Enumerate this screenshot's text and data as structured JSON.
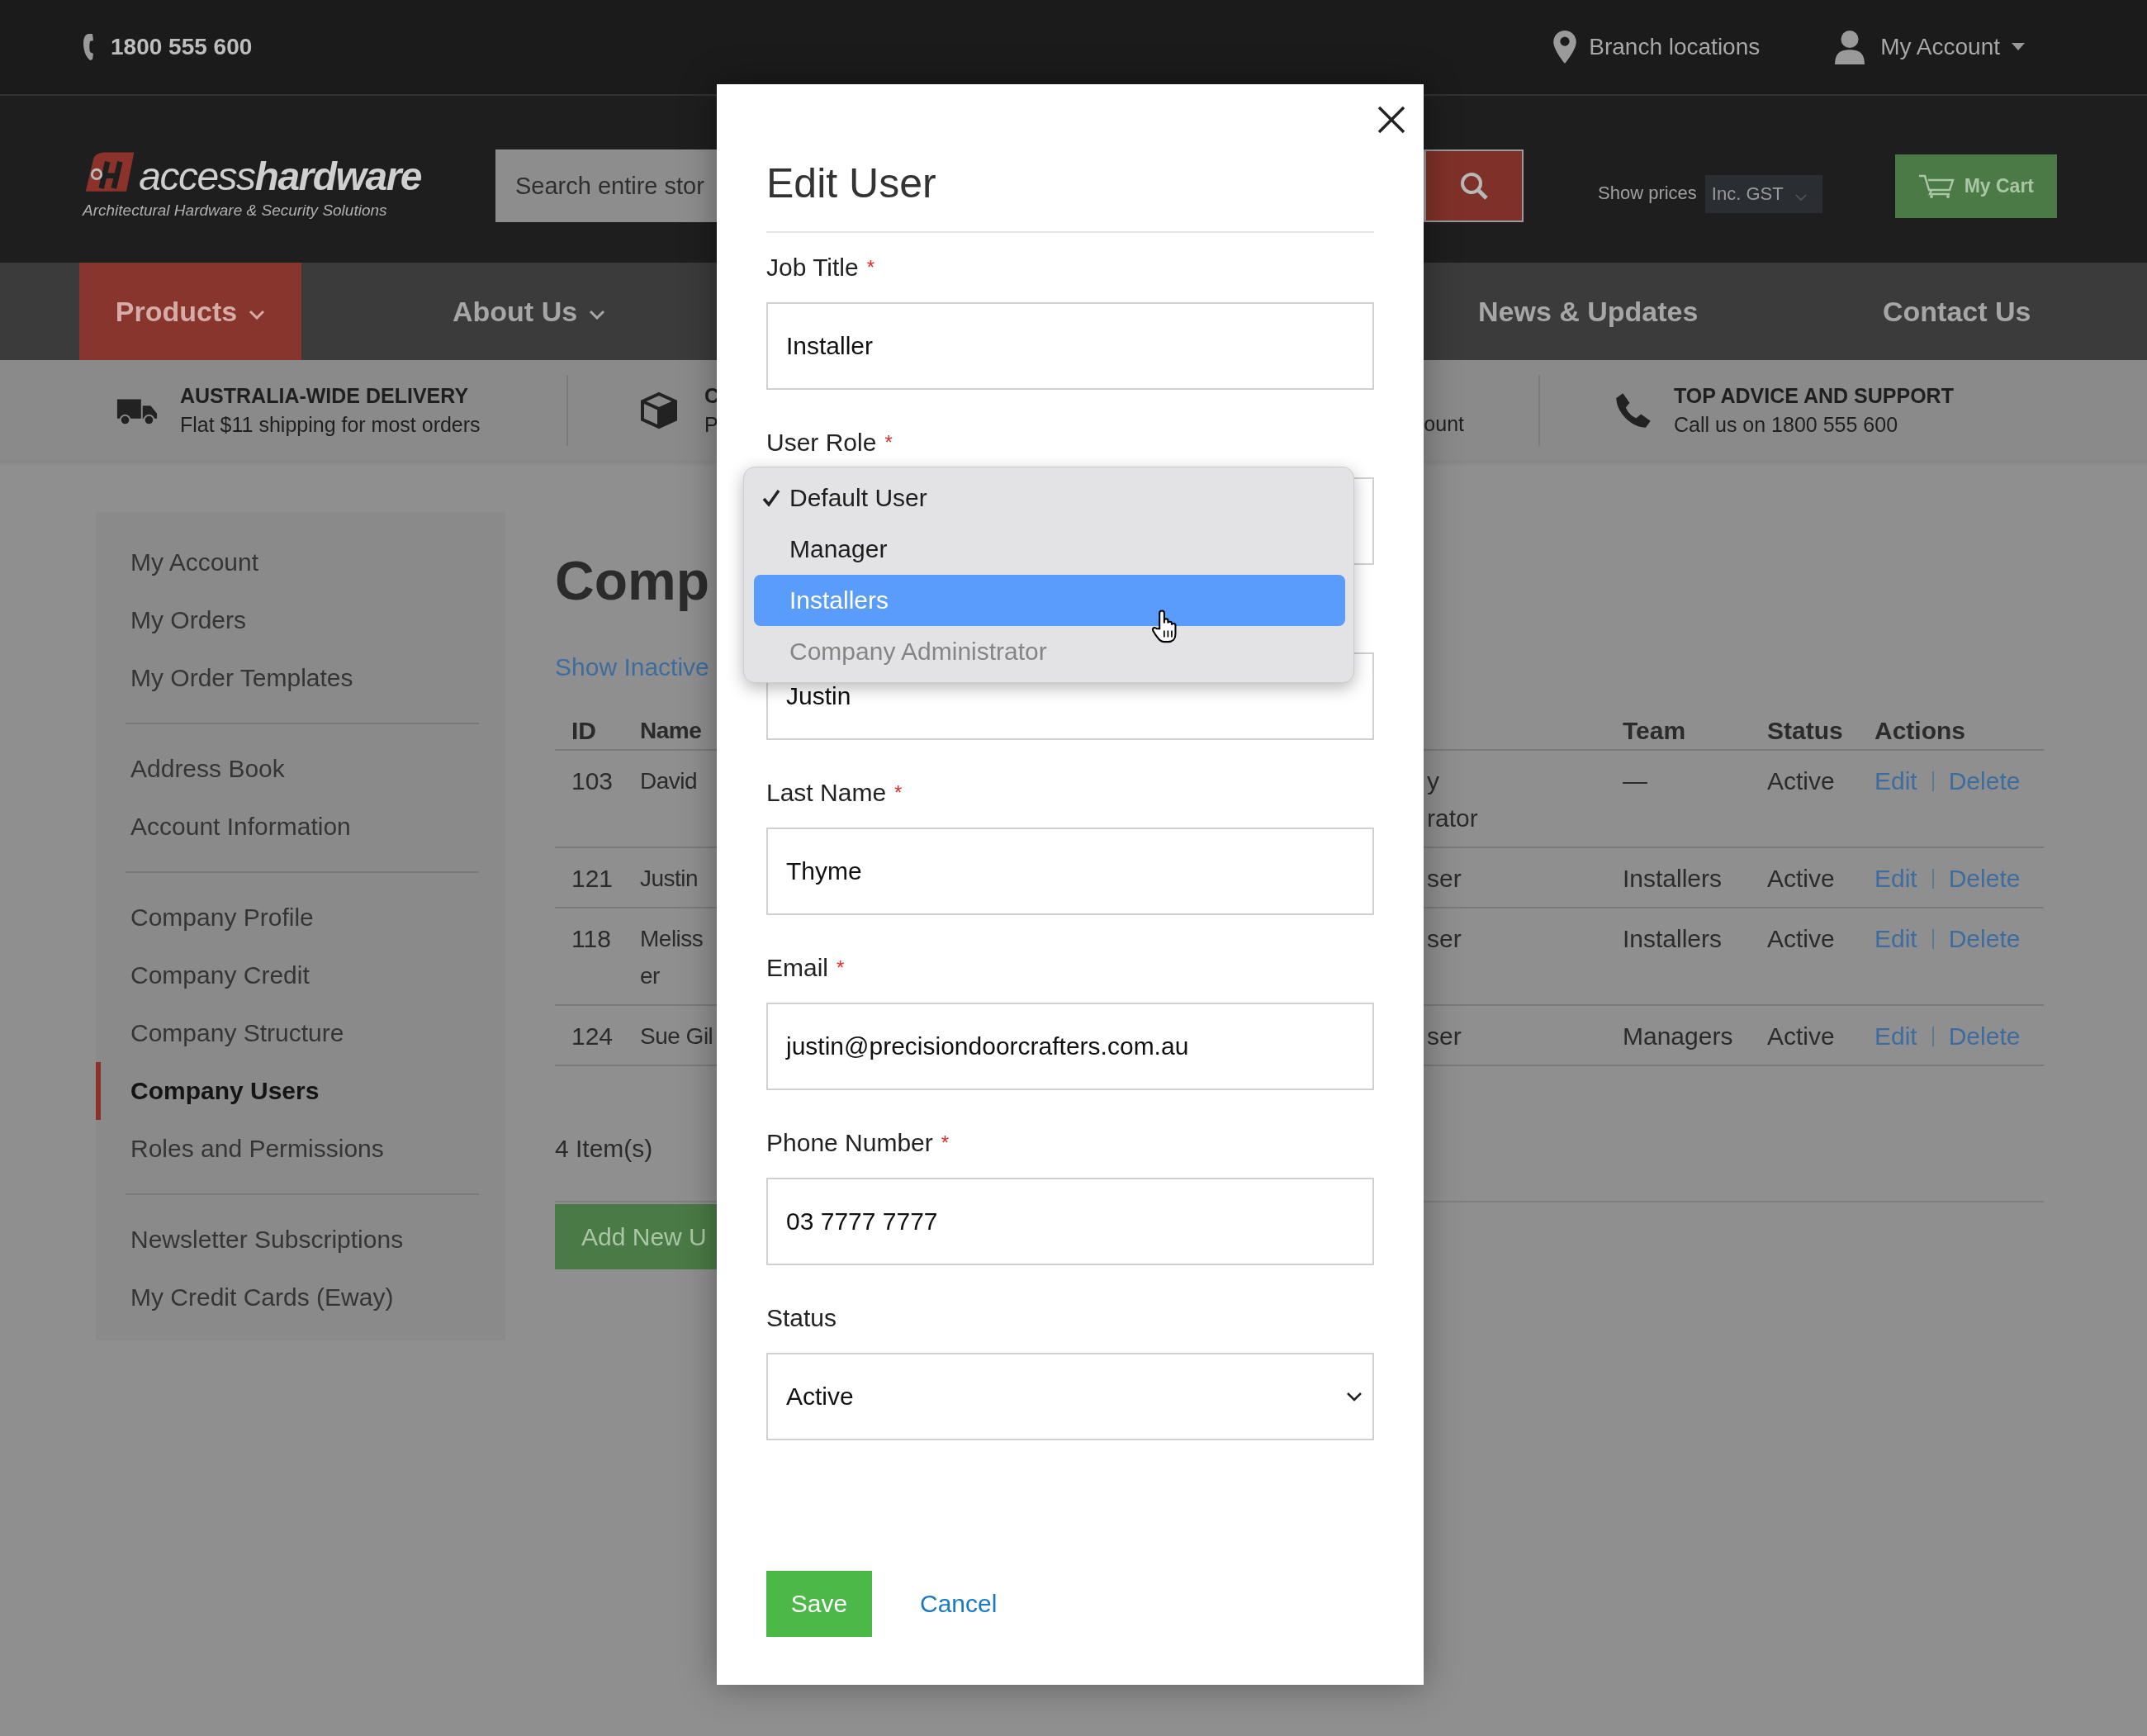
{
  "top_bar": {
    "phone": "1800 555 600",
    "branch_link": "Branch locations",
    "account_link": "My Account"
  },
  "header": {
    "logo_text": "access**hardware**",
    "logo_tagline": "Architectural Hardware & Security Solutions",
    "search_placeholder": "Search entire stor",
    "show_prices_label": "Show prices",
    "price_option": "Inc. GST",
    "cart_label": "My Cart"
  },
  "nav": [
    {
      "label": "Products",
      "selected": true,
      "has_menu": true
    },
    {
      "label": "About Us",
      "selected": false,
      "has_menu": true
    },
    {
      "label": "News & Updates",
      "selected": false,
      "has_menu": false
    },
    {
      "label": "Contact Us",
      "selected": false,
      "has_menu": false
    }
  ],
  "benefits": [
    {
      "title": "AUSTRALIA-WIDE DELIVERY",
      "text": "Flat $11 shipping for most orders"
    },
    {
      "title": "C",
      "text": "P"
    },
    {
      "text": "ount"
    },
    {
      "title": "TOP ADVICE AND SUPPORT",
      "text": "Call us on 1800 555 600"
    }
  ],
  "sidebar": {
    "groups": [
      {
        "items": [
          {
            "label": "My Account",
            "selected": false
          },
          {
            "label": "My Orders",
            "selected": false
          },
          {
            "label": "My Order Templates",
            "selected": false
          }
        ]
      },
      {
        "items": [
          {
            "label": "Address Book",
            "selected": false
          },
          {
            "label": "Account Information",
            "selected": false
          }
        ]
      },
      {
        "items": [
          {
            "label": "Company Profile",
            "selected": false
          },
          {
            "label": "Company Credit",
            "selected": false
          },
          {
            "label": "Company Structure",
            "selected": false
          },
          {
            "label": "Company Users",
            "selected": true
          },
          {
            "label": "Roles and Permissions",
            "selected": false
          }
        ]
      },
      {
        "items": [
          {
            "label": "Newsletter Subscriptions",
            "selected": false
          },
          {
            "label": "My Credit Cards (Eway)",
            "selected": false
          }
        ]
      }
    ]
  },
  "page_title": "Comp",
  "show_inactive_link": "Show Inactive",
  "table": {
    "columns": {
      "id": "ID",
      "name": "Name",
      "team": "Team",
      "status": "Status",
      "actions": "Actions"
    },
    "rows": [
      {
        "id": "103",
        "name": [
          "David"
        ],
        "column_3": [
          "y",
          "rator"
        ],
        "team": "—",
        "status": "Active",
        "actions": [
          "Edit",
          "Delete"
        ]
      },
      {
        "id": "121",
        "name": [
          "Justin"
        ],
        "column_3": [
          "ser"
        ],
        "team": "Installers",
        "status": "Active",
        "actions": [
          "Edit",
          "Delete"
        ]
      },
      {
        "id": "118",
        "name": [
          "Meliss",
          "er"
        ],
        "column_3": [
          "ser"
        ],
        "team": "Installers",
        "status": "Active",
        "actions": [
          "Edit",
          "Delete"
        ]
      },
      {
        "id": "124",
        "name": [
          "Sue Gil"
        ],
        "column_3": [
          "ser"
        ],
        "team": "Managers",
        "status": "Active",
        "actions": [
          "Edit",
          "Delete"
        ]
      }
    ]
  },
  "item_count": "4 Item(s)",
  "add_button": "Add New U",
  "modal": {
    "title": "Edit User",
    "required_mark": "*",
    "fields": [
      {
        "kind": "text",
        "label": "Job Title",
        "required": true,
        "value": "Installer"
      },
      {
        "kind": "dropdown",
        "label": "User Role",
        "required": true,
        "options": [
          {
            "label": "Default User",
            "selected": true,
            "highlighted": false,
            "disabled": false
          },
          {
            "label": "Manager",
            "selected": false,
            "highlighted": false,
            "disabled": false
          },
          {
            "label": "Installers",
            "selected": false,
            "highlighted": true,
            "disabled": false
          },
          {
            "label": "Company Administrator",
            "selected": false,
            "highlighted": false,
            "disabled": true
          }
        ]
      },
      {
        "kind": "text",
        "value": "Justin"
      },
      {
        "kind": "text",
        "label": "Last Name",
        "required": true,
        "value": "Thyme"
      },
      {
        "kind": "text",
        "label": "Email",
        "required": true,
        "value": "justin@precisiondoorcrafters.com.au"
      },
      {
        "kind": "text",
        "label": "Phone Number",
        "required": true,
        "value": "03 7777 7777"
      },
      {
        "kind": "select",
        "label": "Status",
        "required": false,
        "value": "Active"
      }
    ],
    "save_button": "Save",
    "cancel_link": "Cancel"
  }
}
